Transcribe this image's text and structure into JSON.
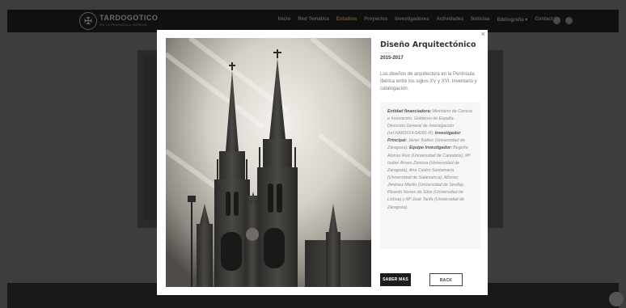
{
  "brand": {
    "name": "TARDOGOTICO",
    "tagline": "EN LA PENÍNSULA IBÉRICA"
  },
  "nav": {
    "items": [
      "Inicio",
      "Red Temática",
      "Estudios",
      "Proyectos",
      "Investigadores",
      "Actividades",
      "Noticias",
      "Bibliografía ▾",
      "Contact Us"
    ]
  },
  "modal": {
    "close": "×",
    "title": "Diseño Arquitectónico",
    "year": "2015-2017",
    "description": "Los diseños de arquitectura en la Península Ibérica entre los siglos XV y XVI. Inventario y catalogación.",
    "info": {
      "funding_label": "Entidad financiadora:",
      "funding_value": " Ministerio de Ciencia e Innovación, Gobierno de España. Dirección General de Investigación (ref.HAR2014-54281-P). ",
      "pi_label": "Investigador Principal:",
      "pi_value": " Javier Ibáñez (Universidad de Zaragoza). ",
      "team_label": "Equipo Investigador:",
      "team_value": " Begoña Alonso Ruiz (Universidad de Cantabria), Mª Isabel Álvaro Zamora (Universidad de Zaragoza), Ana Castro Santamaría (Universidad de Salamanca), Alfonso Jiménez Martín (Universidad de Sevilla), Ricardo Nunes da Silva (Universidad de Lisboa) y Mª José Tarifa (Universidad de Zaragoza)."
    },
    "primary_button": "SABER MAS",
    "back_button": "BACK"
  },
  "colors": {
    "accent": "#6f5a3b",
    "overlay": "#3d3d3d",
    "button_dark": "#1c1c1c"
  },
  "icons": {
    "close": "close-icon",
    "social": [
      "facebook-icon",
      "twitter-icon"
    ]
  }
}
